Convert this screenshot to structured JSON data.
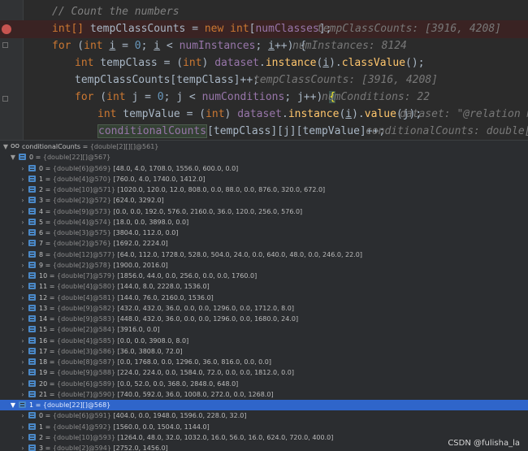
{
  "editor": {
    "line1": {
      "comment": "// Count the numbers"
    },
    "line2": {
      "t1": "int[] ",
      "var": "tempClassCounts",
      "t2": " = ",
      "kw_new": "new",
      "t3": " ",
      "kw_int": "int",
      "t4": "[",
      "fld": "numClasses",
      "t5": "];",
      "hint": "tempClassCounts: [3916, 4208]"
    },
    "line3": {
      "kw_for": "for",
      "t1": " (",
      "kw_int": "int",
      "t2": " ",
      "i1": "i",
      "t3": " = ",
      "zero": "0",
      "t4": "; ",
      "i2": "i",
      "t5": " < ",
      "fld": "numInstances",
      "t6": "; ",
      "i3": "i",
      "t7": "++) {",
      "hint": "numInstances: 8124"
    },
    "line4": {
      "kw_int": "int",
      "t1": " tempClass = (",
      "kw_int2": "int",
      "t2": ") ",
      "fld": "dataset",
      "t3": ".",
      "fn1": "instance",
      "t4": "(",
      "i": "i",
      "t5": ").",
      "fn2": "classValue",
      "t6": "();"
    },
    "line5": {
      "t1": "tempClassCounts[tempClass]++;",
      "hint": "tempClassCounts: [3916, 4208]"
    },
    "line6": {
      "kw_for": "for",
      "t1": " (",
      "kw_int": "int",
      "t2": " j = ",
      "zero": "0",
      "t3": "; j < ",
      "fld": "numConditions",
      "t4": "; j++) ",
      "brace": "{",
      "hint": "numConditions: 22"
    },
    "line7": {
      "kw_int": "int",
      "t1": " tempValue = (",
      "kw_int2": "int",
      "t2": ") ",
      "fld": "dataset",
      "t3": ".",
      "fn1": "instance",
      "t4": "(",
      "i": "i",
      "t5": ").",
      "fn2": "value",
      "t6": "(j);",
      "hint": "dataset: \"@relation mus"
    },
    "line8": {
      "fld": "conditionalCounts",
      "t1": "[tempClass][j][tempValue]++;",
      "hint": "conditionalCounts: double[2]["
    }
  },
  "variables": {
    "root": {
      "name": "conditionalCounts",
      "type": "{double[2][][]@561}"
    },
    "groups": [
      {
        "name": "0",
        "type": "{double[22][]@567}",
        "items": [
          {
            "name": "0",
            "type": "{double[6]@569}",
            "value": "[48.0, 4.0, 1708.0, 1556.0, 600.0, 0.0]"
          },
          {
            "name": "1",
            "type": "{double[4]@570}",
            "value": "[760.0, 4.0, 1740.0, 1412.0]"
          },
          {
            "name": "2",
            "type": "{double[10]@571}",
            "value": "[1020.0, 120.0, 12.0, 808.0, 0.0, 88.0, 0.0, 876.0, 320.0, 672.0]"
          },
          {
            "name": "3",
            "type": "{double[2]@572}",
            "value": "[624.0, 3292.0]"
          },
          {
            "name": "4",
            "type": "{double[9]@573}",
            "value": "[0.0, 0.0, 192.0, 576.0, 2160.0, 36.0, 120.0, 256.0, 576.0]"
          },
          {
            "name": "5",
            "type": "{double[4]@574}",
            "value": "[18.0, 0.0, 3898.0, 0.0]"
          },
          {
            "name": "6",
            "type": "{double[3]@575}",
            "value": "[3804.0, 112.0, 0.0]"
          },
          {
            "name": "7",
            "type": "{double[2]@576}",
            "value": "[1692.0, 2224.0]"
          },
          {
            "name": "8",
            "type": "{double[12]@577}",
            "value": "[64.0, 112.0, 1728.0, 528.0, 504.0, 24.0, 0.0, 640.0, 48.0, 0.0, 246.0, 22.0]"
          },
          {
            "name": "9",
            "type": "{double[2]@578}",
            "value": "[1900.0, 2016.0]"
          },
          {
            "name": "10",
            "type": "{double[7]@579}",
            "value": "[1856.0, 44.0, 0.0, 256.0, 0.0, 0.0, 1760.0]"
          },
          {
            "name": "11",
            "type": "{double[4]@580}",
            "value": "[144.0, 8.0, 2228.0, 1536.0]"
          },
          {
            "name": "12",
            "type": "{double[4]@581}",
            "value": "[144.0, 76.0, 2160.0, 1536.0]"
          },
          {
            "name": "13",
            "type": "{double[9]@582}",
            "value": "[432.0, 432.0, 36.0, 0.0, 0.0, 1296.0, 0.0, 1712.0, 8.0]"
          },
          {
            "name": "14",
            "type": "{double[9]@583}",
            "value": "[448.0, 432.0, 36.0, 0.0, 0.0, 1296.0, 0.0, 1680.0, 24.0]"
          },
          {
            "name": "15",
            "type": "{double[2]@584}",
            "value": "[3916.0, 0.0]"
          },
          {
            "name": "16",
            "type": "{double[4]@585}",
            "value": "[0.0, 0.0, 3908.0, 8.0]"
          },
          {
            "name": "17",
            "type": "{double[3]@586}",
            "value": "[36.0, 3808.0, 72.0]"
          },
          {
            "name": "18",
            "type": "{double[8]@587}",
            "value": "[0.0, 1768.0, 0.0, 1296.0, 36.0, 816.0, 0.0, 0.0]"
          },
          {
            "name": "19",
            "type": "{double[9]@588}",
            "value": "[224.0, 224.0, 0.0, 1584.0, 72.0, 0.0, 0.0, 1812.0, 0.0]"
          },
          {
            "name": "20",
            "type": "{double[6]@589}",
            "value": "[0.0, 52.0, 0.0, 368.0, 2848.0, 648.0]"
          },
          {
            "name": "21",
            "type": "{double[7]@590}",
            "value": "[740.0, 592.0, 36.0, 1008.0, 272.0, 0.0, 1268.0]"
          }
        ]
      },
      {
        "name": "1",
        "type": "{double[22][]@568}",
        "items": [
          {
            "name": "0",
            "type": "{double[6]@591}",
            "value": "[404.0, 0.0, 1948.0, 1596.0, 228.0, 32.0]"
          },
          {
            "name": "1",
            "type": "{double[4]@592}",
            "value": "[1560.0, 0.0, 1504.0, 1144.0]"
          },
          {
            "name": "2",
            "type": "{double[10]@593}",
            "value": "[1264.0, 48.0, 32.0, 1032.0, 16.0, 56.0, 16.0, 624.0, 720.0, 400.0]"
          },
          {
            "name": "3",
            "type": "{double[2]@594}",
            "value": "[2752.0, 1456.0]"
          },
          {
            "name": "4",
            "type": "{double[9]@595}",
            "value": "[400.0, 400.0, 0.0, 0.0, 0.0, 0.0, 3408.0, 0.0, 0.0]"
          }
        ]
      }
    ]
  },
  "watermark": "CSDN @fulisha_la"
}
